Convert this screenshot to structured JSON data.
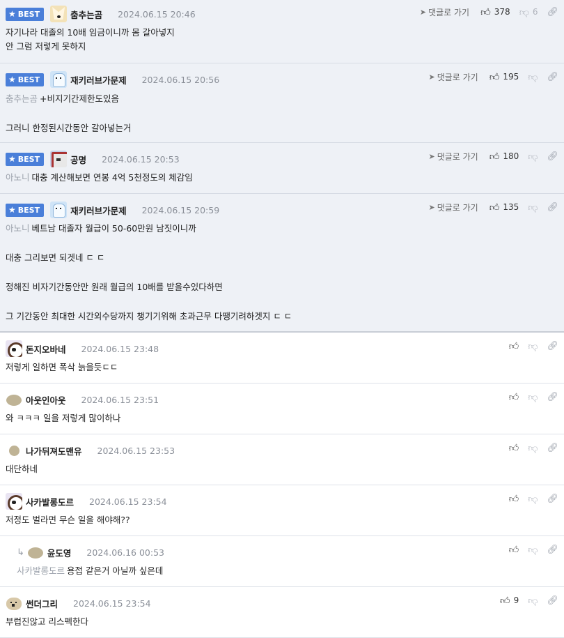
{
  "best_label": "BEST",
  "goto_label": "댓글로 가기",
  "comments": [
    {
      "nick": "춤추는곰",
      "date": "2024.06.15 20:46",
      "up": "378",
      "down": "6",
      "best": true,
      "lines": [
        "자기나라 대졸의 10배 임금이니까 몸 갈아넣지",
        "안 그럼 저렇게 못하지"
      ]
    },
    {
      "nick": "재키러브가문제",
      "date": "2024.06.15 20:56",
      "up": "195",
      "down": "",
      "best": true,
      "mention": "춤추는곰",
      "first": "+비지기간제한도있음",
      "rest": [
        "그러니 한정된시간동안 갈아넣는거"
      ]
    },
    {
      "nick": "공명",
      "date": "2024.06.15 20:53",
      "up": "180",
      "down": "",
      "best": true,
      "mention": "아노니",
      "first": "대충 계산해보면 연봉 4억 5천정도의 체감임"
    },
    {
      "nick": "재키러브가문제",
      "date": "2024.06.15 20:59",
      "up": "135",
      "down": "",
      "best": true,
      "mention": "아노니",
      "first": "베트남 대졸자 월급이 50-60만원 남짓이니까",
      "rest": [
        "대충 그리보면 되겟네 ㄷ ㄷ",
        "정해진 비자기간동안만 원래 월급의 10배를 받을수있다하면",
        "그 기간동안 최대한 시간외수당까지 챙기기위해 초과근무 다땡기려하겟지 ㄷ ㄷ"
      ]
    },
    {
      "nick": "돈지오바네",
      "date": "2024.06.15 23:48",
      "up": "",
      "down": "",
      "lines": [
        "저렇게 일하면 폭삭 늙을듯ㄷㄷ"
      ]
    },
    {
      "nick": "아웃인아웃",
      "date": "2024.06.15 23:51",
      "up": "",
      "down": "",
      "lines": [
        "와 ㅋㅋㅋ 일을 저렇게 많이하나"
      ]
    },
    {
      "nick": "나가뒤져도맨유",
      "date": "2024.06.15 23:53",
      "up": "",
      "down": "",
      "lines": [
        "대단하네"
      ]
    },
    {
      "nick": "사카발롱도르",
      "date": "2024.06.15 23:54",
      "up": "",
      "down": "",
      "lines": [
        "저정도 벌라면 무슨 일을 해야해??"
      ]
    },
    {
      "nick": "윤도영",
      "date": "2024.06.16 00:53",
      "up": "",
      "down": "",
      "reply": true,
      "mention": "사카발롱도르",
      "first": "용접 같은거 아닐까 싶은데"
    },
    {
      "nick": "썬더그리",
      "date": "2024.06.15 23:54",
      "up": "9",
      "down": "",
      "lines": [
        "부럽진않고 리스펙한다"
      ]
    }
  ]
}
